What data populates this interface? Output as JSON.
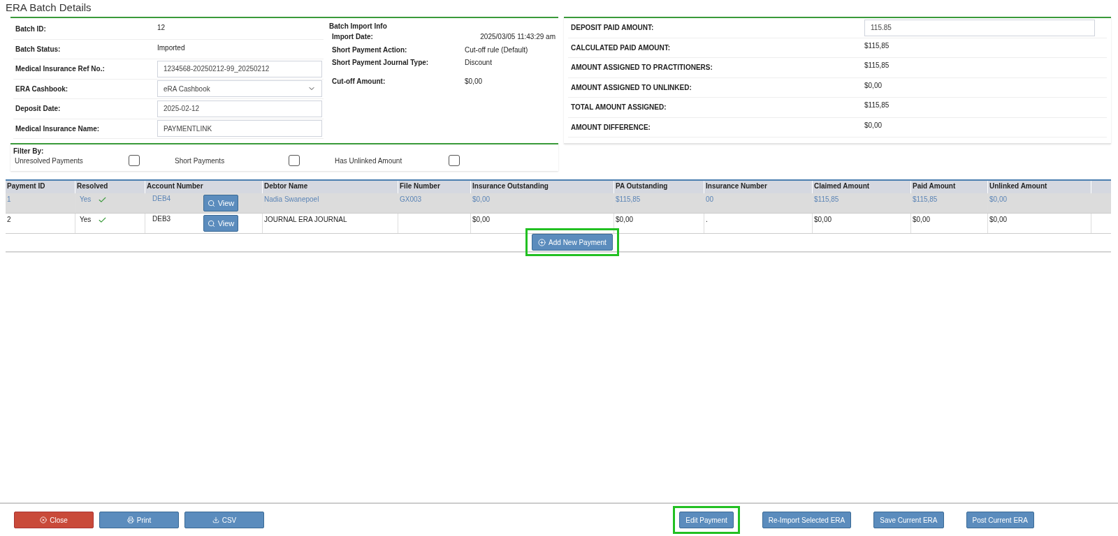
{
  "title": "ERA Batch Details",
  "batch_fields": [
    {
      "kind": "text",
      "label": "Batch ID:",
      "value": "12"
    },
    {
      "kind": "text",
      "label": "Batch Status:",
      "value": "Imported"
    },
    {
      "kind": "input",
      "label": "Medical Insurance Ref No.:",
      "value": "1234568-20250212-99_20250212"
    },
    {
      "kind": "select",
      "label": "ERA Cashbook:",
      "value": "eRA Cashbook"
    },
    {
      "kind": "input",
      "label": "Deposit Date:",
      "value": "2025-02-12"
    },
    {
      "kind": "input",
      "label": "Medical Insurance Name:",
      "value": "PAYMENTLINK"
    }
  ],
  "import_info": {
    "title": "Batch Import Info",
    "items": [
      {
        "label": "Import Date:",
        "value": "2025/03/05 11:43:29 am"
      },
      {
        "label": "Short Payment Action:",
        "value": "Cut-off rule (Default)"
      },
      {
        "label": "Short Payment Journal Type:",
        "value": "Discount"
      },
      {
        "label": "Cut-off Amount:",
        "value": "$0,00"
      }
    ]
  },
  "amounts": [
    {
      "kind": "input",
      "label": "DEPOSIT PAID AMOUNT:",
      "value": "115.85"
    },
    {
      "kind": "text",
      "label": "CALCULATED PAID AMOUNT:",
      "value": "$115,85"
    },
    {
      "kind": "text",
      "label": "AMOUNT ASSIGNED TO PRACTITIONERS:",
      "value": "$115,85"
    },
    {
      "kind": "text",
      "label": "AMOUNT ASSIGNED TO UNLINKED:",
      "value": "$0,00"
    },
    {
      "kind": "text",
      "label": "TOTAL AMOUNT ASSIGNED:",
      "value": "$115,85"
    },
    {
      "kind": "text",
      "label": "AMOUNT DIFFERENCE:",
      "value": "$0,00"
    }
  ],
  "filter": {
    "title": "Filter By:",
    "options": [
      {
        "label": "Unresolved Payments",
        "checked": false
      },
      {
        "label": "Short Payments",
        "checked": false
      },
      {
        "label": "Has Unlinked Amount",
        "checked": false
      }
    ]
  },
  "table": {
    "columns": [
      "Payment ID",
      "Resolved",
      "Account Number",
      "Debtor Name",
      "File Number",
      "Insurance Outstanding",
      "PA Outstanding",
      "Insurance Number",
      "Claimed Amount",
      "Paid Amount",
      "Unlinked Amount"
    ],
    "rows": [
      {
        "selected": true,
        "payment_id": "1",
        "resolved": "Yes",
        "resolved_check": true,
        "account": "DEB4",
        "view": "View",
        "debtor": "Nadia Swanepoel",
        "file": "GX003",
        "insurance_outstanding": "$0,00",
        "pa_outstanding": "$115,85",
        "insurance_number": "00",
        "claimed": "$115,85",
        "paid": "$115,85",
        "unlinked": "$0,00"
      },
      {
        "selected": false,
        "payment_id": "2",
        "resolved": "Yes",
        "resolved_check": true,
        "account": "DEB3",
        "view": "View",
        "debtor": "JOURNAL ERA JOURNAL",
        "insurance_outstanding": "$0,00",
        "pa_outstanding": "$0,00",
        "insurance_number": ".",
        "claimed": "$0,00",
        "paid": "$0,00",
        "unlinked": "$0,00"
      }
    ],
    "add_button": {
      "label": "Add New Payment",
      "highlighted": true
    }
  },
  "footer": {
    "left_buttons": [
      {
        "kind": "close",
        "label": "Close",
        "highlighted": false
      },
      {
        "kind": "print",
        "label": "Print",
        "highlighted": false
      },
      {
        "kind": "csv",
        "label": "CSV",
        "highlighted": false
      }
    ],
    "right_buttons": [
      {
        "kind": "plain",
        "label": "Edit Payment",
        "highlighted": true
      },
      {
        "kind": "plain",
        "label": "Re-Import Selected ERA",
        "highlighted": false
      },
      {
        "kind": "plain",
        "label": "Save Current ERA",
        "highlighted": false
      },
      {
        "kind": "plain",
        "label": "Post Current ERA",
        "highlighted": false
      }
    ]
  }
}
